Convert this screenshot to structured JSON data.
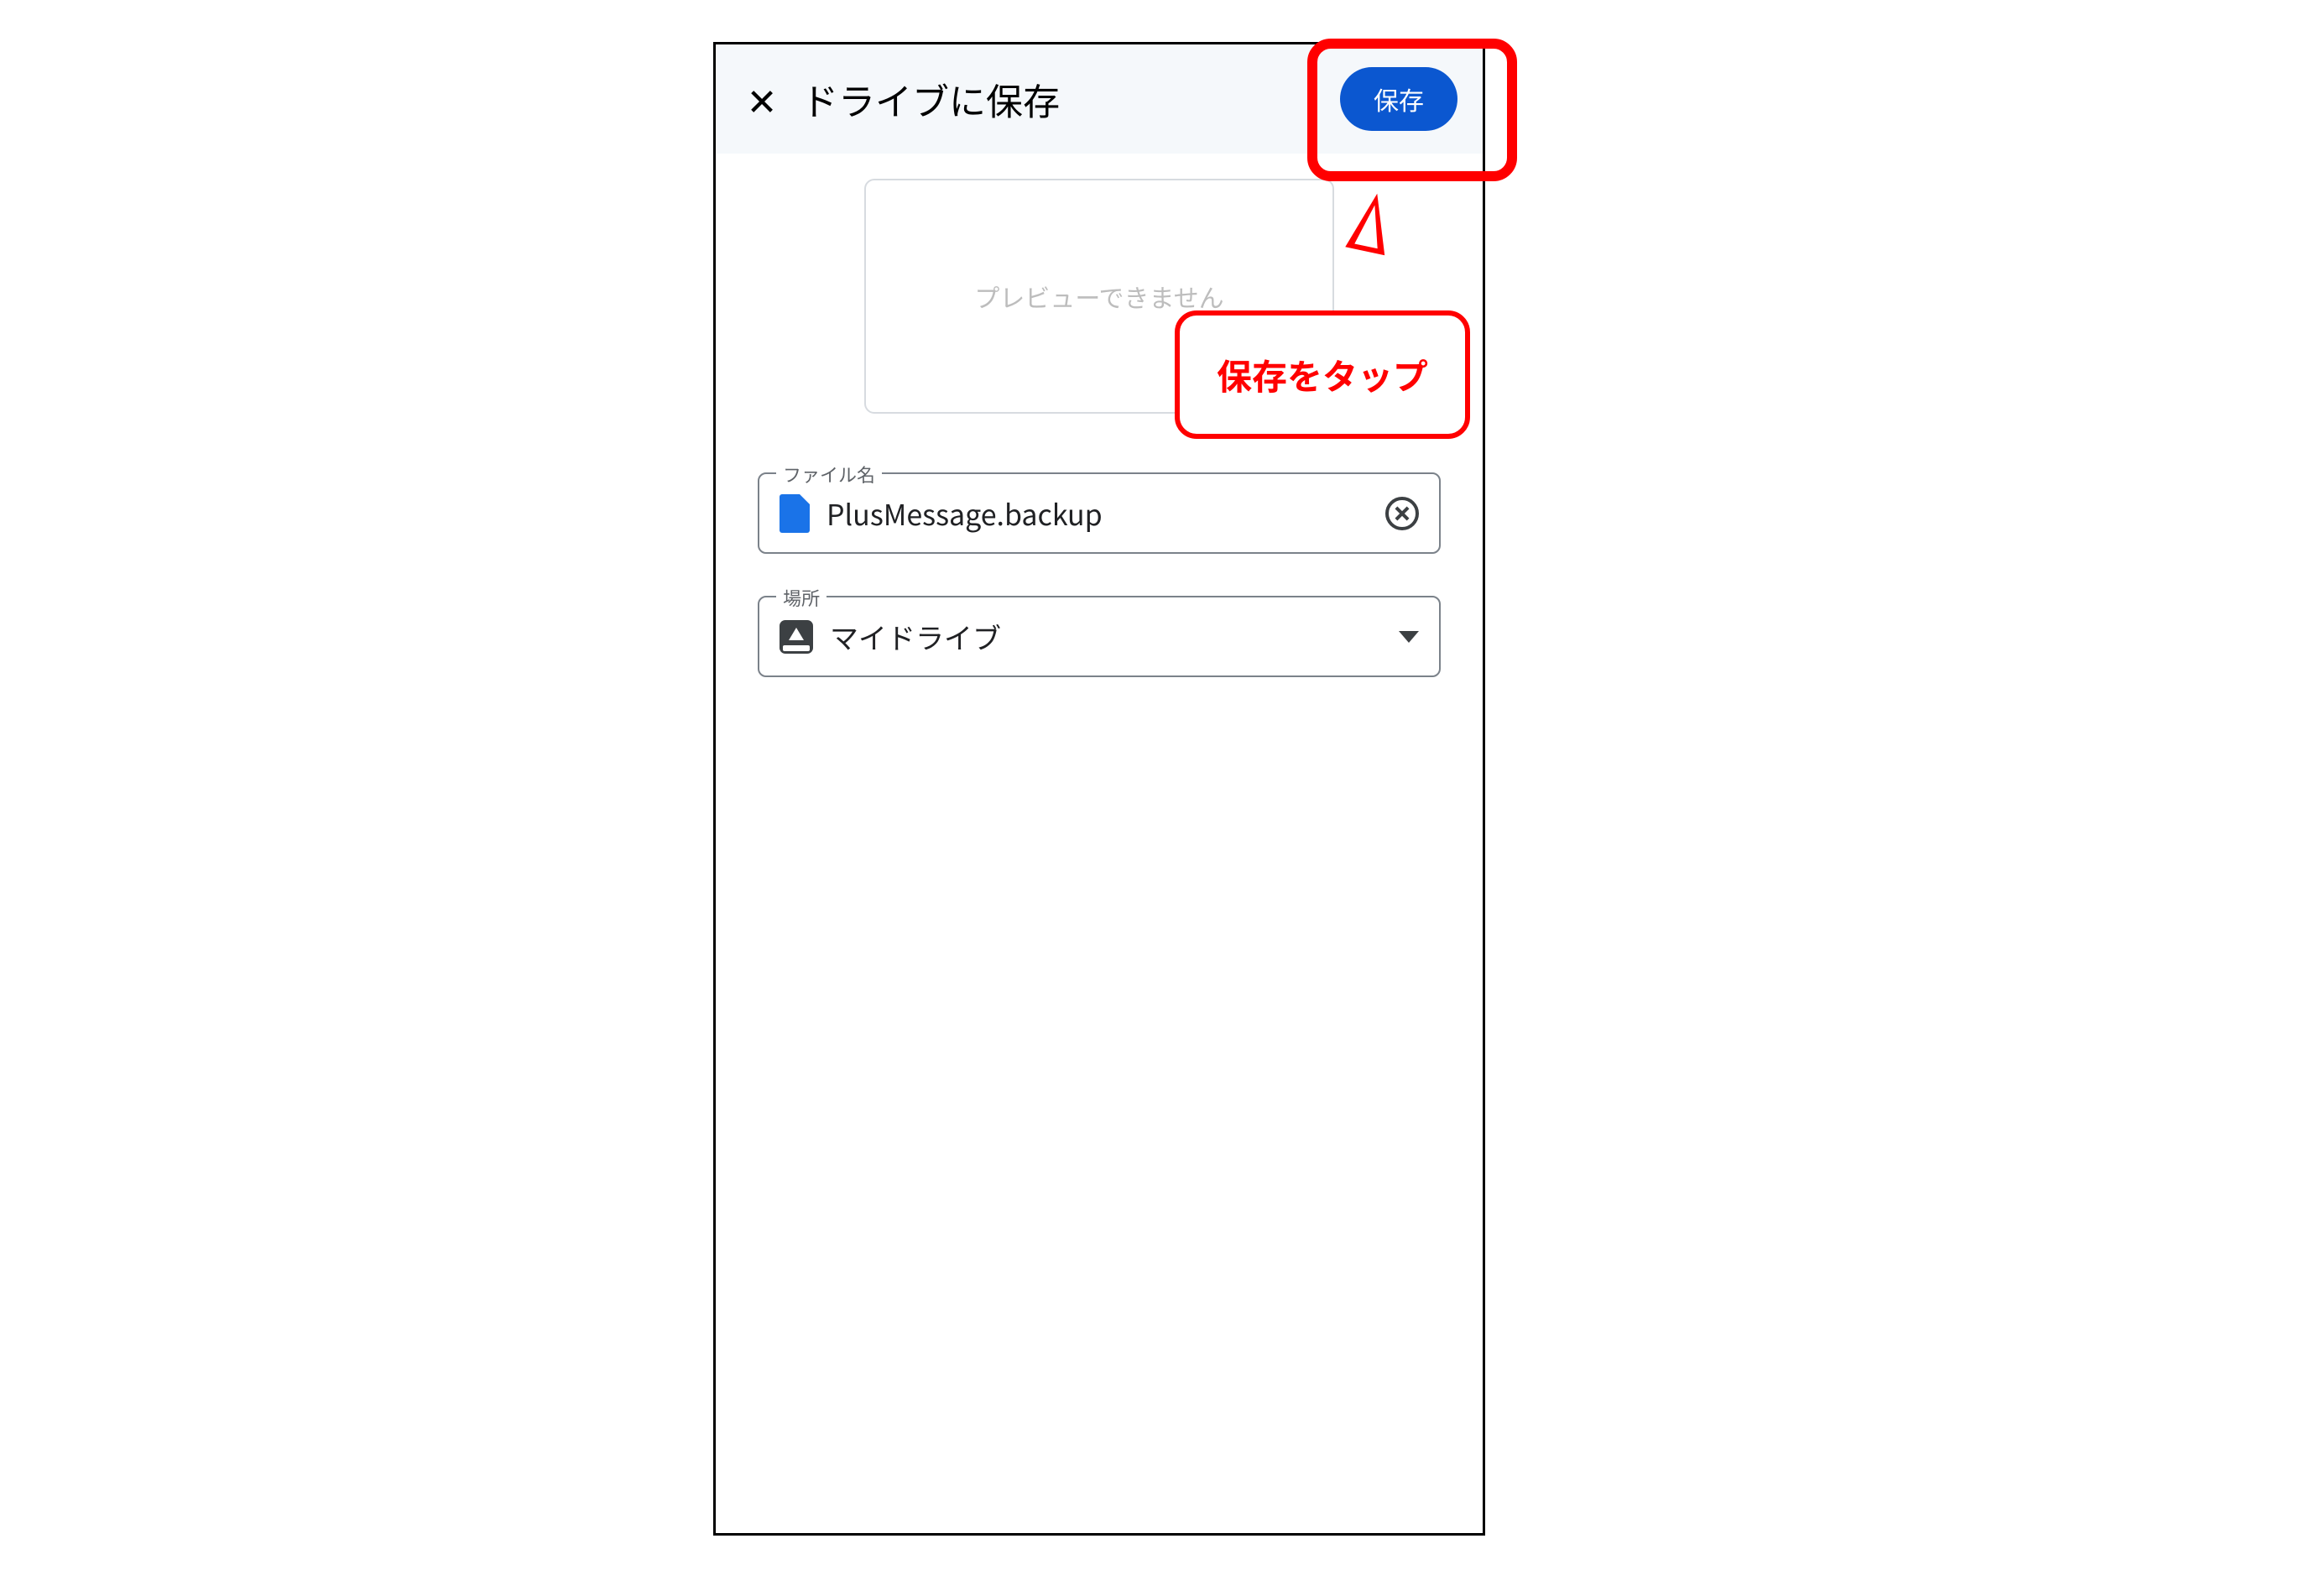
{
  "header": {
    "title": "ドライブに保存",
    "save_label": "保存"
  },
  "preview": {
    "text": "プレビューできません"
  },
  "filename_field": {
    "label": "ファイル名",
    "value": "PlusMessage.backup"
  },
  "location_field": {
    "label": "場所",
    "value": "マイドライブ"
  },
  "annotation": {
    "callout_text": "保存をタップ"
  }
}
